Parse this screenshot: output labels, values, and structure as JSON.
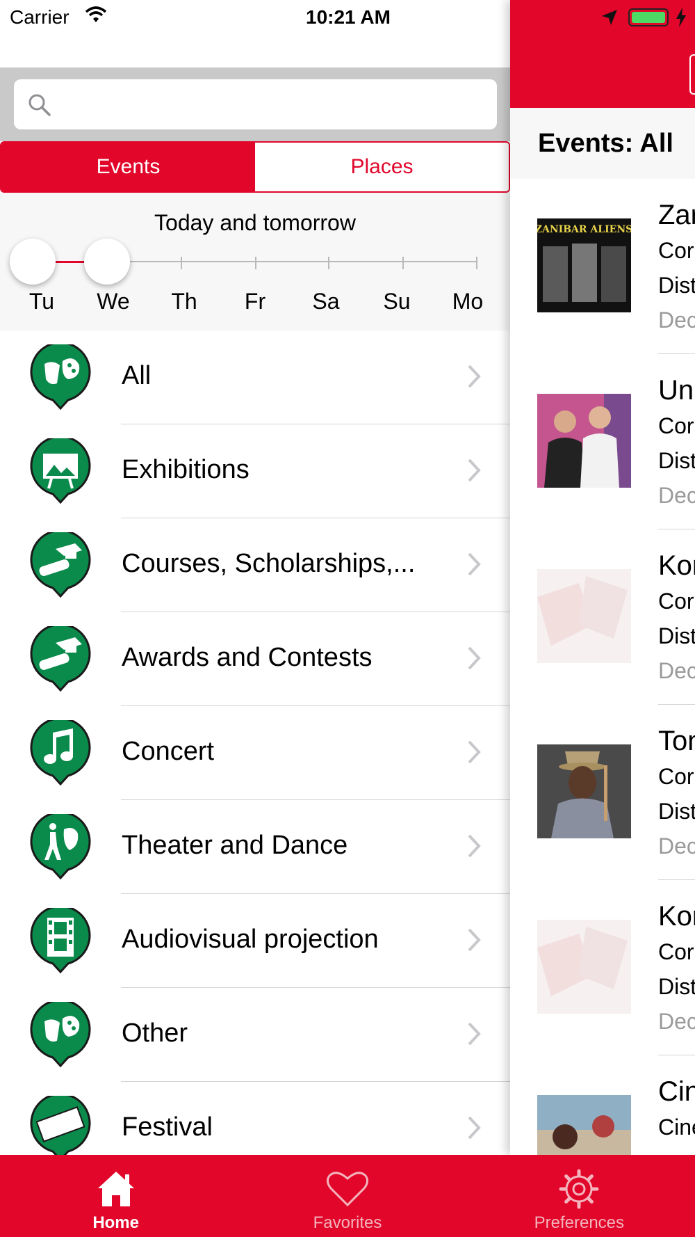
{
  "status_bar": {
    "carrier": "Carrier",
    "time": "10:21 AM"
  },
  "search": {
    "placeholder": "",
    "value": ""
  },
  "segment": {
    "events": "Events",
    "places": "Places",
    "selected": "Events"
  },
  "date_range": {
    "title": "Today and tomorrow",
    "days": [
      "Tu",
      "We",
      "Th",
      "Fr",
      "Sa",
      "Su",
      "Mo"
    ],
    "selected_start": "Tu",
    "selected_end": "We"
  },
  "categories": [
    {
      "label": "All",
      "icon": "masks-palette-icon"
    },
    {
      "label": "Exhibitions",
      "icon": "easel-picture-icon"
    },
    {
      "label": "Courses, Scholarships,...",
      "icon": "graduation-cap-icon"
    },
    {
      "label": "Awards and Contests",
      "icon": "graduation-cap-icon"
    },
    {
      "label": "Concert",
      "icon": "music-note-icon"
    },
    {
      "label": "Theater and Dance",
      "icon": "dancer-mask-icon"
    },
    {
      "label": "Audiovisual projection",
      "icon": "film-strip-icon"
    },
    {
      "label": "Other",
      "icon": "masks-palette-icon"
    },
    {
      "label": "Festival",
      "icon": "fest-sign-icon"
    }
  ],
  "events_panel": {
    "title": "Events: All",
    "events": [
      {
        "t1": "Zar",
        "t2": "Cor",
        "t3": "Dist",
        "t4": "Dec",
        "thumb_text": "ZANIBAR ALIENS"
      },
      {
        "t1": "Un",
        "t2": "Cor",
        "t3": "Dist",
        "t4": "Dec"
      },
      {
        "t1": "Kor",
        "t2": "Cor",
        "t3": "Dist",
        "t4": "Dec"
      },
      {
        "t1": "Ton",
        "t2": "Cor",
        "t3": "Dist",
        "t4": "Dec"
      },
      {
        "t1": "Kor",
        "t2": "Cor",
        "t3": "Dist",
        "t4": "Dec"
      },
      {
        "t1": "Cin",
        "t2": "Cine",
        "t3": "",
        "t4": ""
      }
    ]
  },
  "tabbar": {
    "home": "Home",
    "favorites": "Favorites",
    "preferences": "Preferences",
    "selected": "Home"
  },
  "colors": {
    "brand_red": "#e1062a",
    "icon_green": "#0a8a4b"
  }
}
